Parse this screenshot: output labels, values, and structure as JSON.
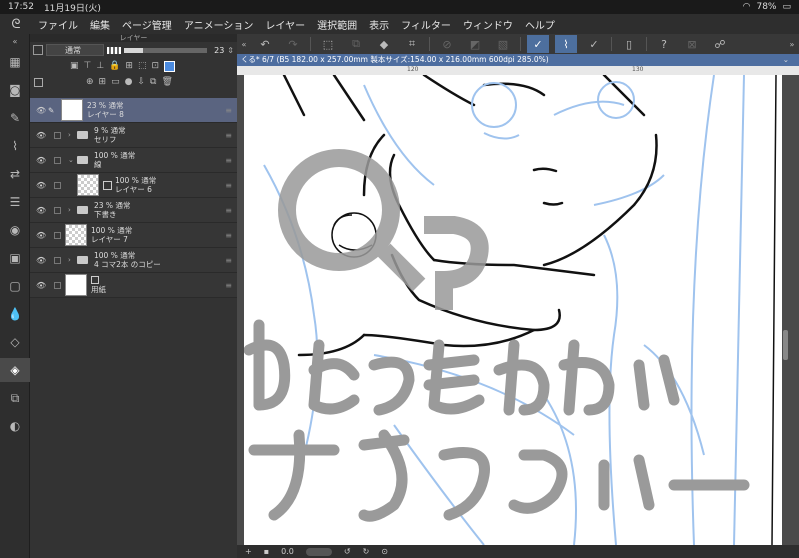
{
  "status": {
    "time": "17:52",
    "date": "11月19日(火)",
    "battery": "78%"
  },
  "menu": [
    "ファイル",
    "編集",
    "ページ管理",
    "アニメーション",
    "レイヤー",
    "選択範囲",
    "表示",
    "フィルター",
    "ウィンドウ",
    "ヘルプ"
  ],
  "panel": {
    "title": "レイヤー",
    "blend_mode": "通常",
    "opacity_value": "23",
    "opacity_fraction": 0.23
  },
  "layers": [
    {
      "opacity": "23 % 通常",
      "name": "レイヤー 8",
      "selected": true
    },
    {
      "opacity": "9 % 通常",
      "name": "セリフ"
    },
    {
      "opacity": "100 % 通常",
      "name": "線"
    },
    {
      "opacity": "100 % 通常",
      "name": "レイヤー 6"
    },
    {
      "opacity": "23 % 通常",
      "name": "下書き"
    },
    {
      "opacity": "100 % 通常",
      "name": "レイヤー 7"
    },
    {
      "opacity": "100 % 通常",
      "name": "4 コマ2本 のコピー"
    },
    {
      "opacity": "",
      "name": "用紙"
    }
  ],
  "canvas": {
    "info": "くる* 6/7 (B5 182.00 x 257.00mm 製本サイズ:154.00 x 216.00mm 600dpi 285.0%)",
    "ruler_120": "120",
    "ruler_130": "130"
  },
  "bottom": {
    "rotation": "0.0"
  },
  "colors": {
    "accent": "#4e6ea0",
    "sketch": "#9fc3ee",
    "watermark": "#9a9a9a"
  }
}
